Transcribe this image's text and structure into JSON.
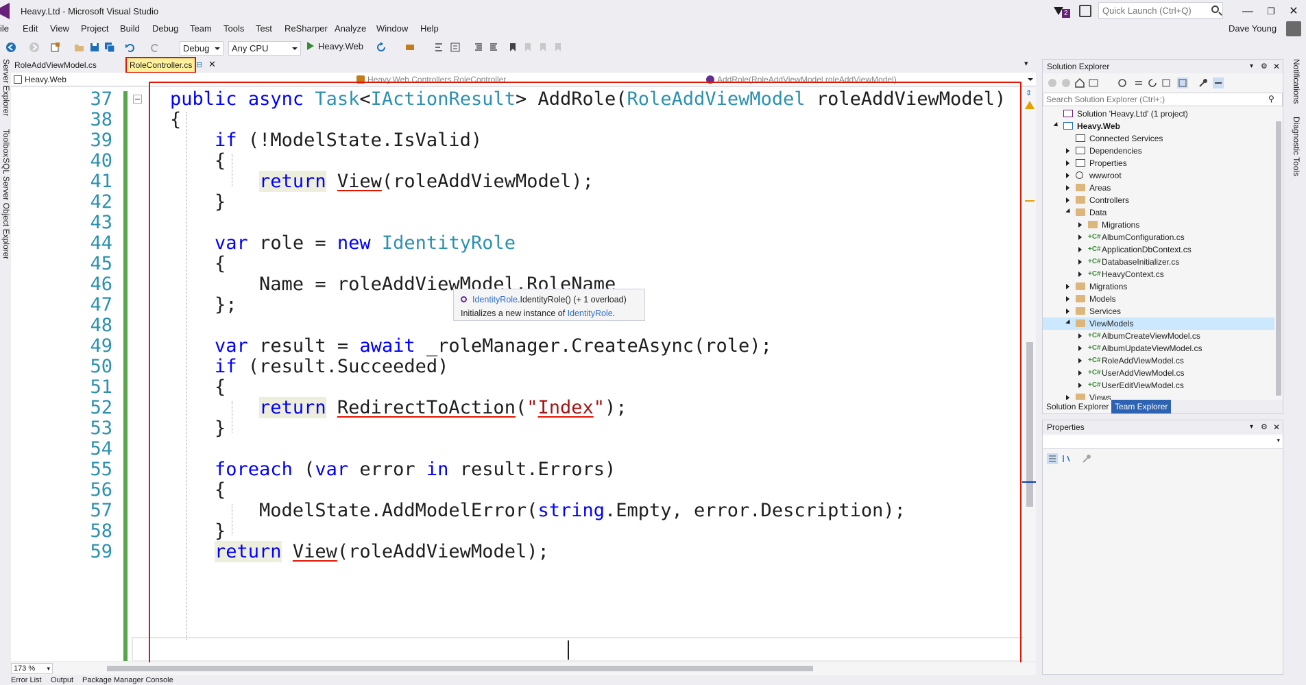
{
  "window": {
    "title": "Heavy.Ltd - Microsoft Visual Studio",
    "notifications_count": "2",
    "quick_launch_placeholder": "Quick Launch (Ctrl+Q)",
    "user_name": "Dave Young"
  },
  "menu": [
    "ile",
    "Edit",
    "View",
    "Project",
    "Build",
    "Debug",
    "Team",
    "Tools",
    "Test",
    "ReSharper",
    "Analyze",
    "Window",
    "Help"
  ],
  "toolbar": {
    "config": "Debug",
    "platform": "Any CPU",
    "run_label": "Heavy.Web"
  },
  "left_rail": [
    "Server Explorer",
    "Toolbox",
    "SQL Server Object Explorer"
  ],
  "right_rail": [
    "Notifications",
    "Diagnostic Tools"
  ],
  "doc_tabs": [
    {
      "label": "RoleAddViewModel.cs",
      "active": false
    },
    {
      "label": "RoleController.cs",
      "active": true
    }
  ],
  "navbar": {
    "project": "Heavy.Web",
    "class": "Heavy.Web.Controllers.RoleController",
    "member": "AddRole(RoleAddViewModel roleAddViewModel)"
  },
  "editor": {
    "zoom": "173 %",
    "line_numbers": [
      "37",
      "38",
      "39",
      "40",
      "41",
      "42",
      "43",
      "44",
      "45",
      "46",
      "47",
      "48",
      "49",
      "50",
      "51",
      "52",
      "53",
      "54",
      "55",
      "56",
      "57",
      "58",
      "59"
    ]
  },
  "tooltip": {
    "type_name": "IdentityRole",
    "signature": ".IdentityRole() (+ 1 overload)",
    "description_prefix": "Initializes a new instance of ",
    "description_link": "IdentityRole",
    "description_suffix": "."
  },
  "solution_explorer": {
    "title": "Solution Explorer",
    "search_placeholder": "Search Solution Explorer (Ctrl+;)",
    "nodes": [
      {
        "label": "Solution 'Heavy.Ltd' (1 project)",
        "level": 0,
        "kind": "solution",
        "exp": "none"
      },
      {
        "label": "Heavy.Web",
        "level": 0,
        "kind": "project",
        "exp": "open",
        "bold": true
      },
      {
        "label": "Connected Services",
        "level": 1,
        "kind": "service",
        "exp": "none"
      },
      {
        "label": "Dependencies",
        "level": 1,
        "kind": "deps",
        "exp": "closed"
      },
      {
        "label": "Properties",
        "level": 1,
        "kind": "wrench",
        "exp": "closed"
      },
      {
        "label": "wwwroot",
        "level": 1,
        "kind": "globe",
        "exp": "closed"
      },
      {
        "label": "Areas",
        "level": 1,
        "kind": "folder",
        "exp": "closed"
      },
      {
        "label": "Controllers",
        "level": 1,
        "kind": "folder",
        "exp": "closed"
      },
      {
        "label": "Data",
        "level": 1,
        "kind": "folder",
        "exp": "open"
      },
      {
        "label": "Migrations",
        "level": 2,
        "kind": "folder",
        "exp": "closed"
      },
      {
        "label": "AlbumConfiguration.cs",
        "level": 2,
        "kind": "cs",
        "exp": "closed"
      },
      {
        "label": "ApplicationDbContext.cs",
        "level": 2,
        "kind": "cs",
        "exp": "closed"
      },
      {
        "label": "DatabaseInitializer.cs",
        "level": 2,
        "kind": "cs",
        "exp": "closed"
      },
      {
        "label": "HeavyContext.cs",
        "level": 2,
        "kind": "cs",
        "exp": "closed"
      },
      {
        "label": "Migrations",
        "level": 1,
        "kind": "folder",
        "exp": "closed"
      },
      {
        "label": "Models",
        "level": 1,
        "kind": "folder",
        "exp": "closed"
      },
      {
        "label": "Services",
        "level": 1,
        "kind": "folder",
        "exp": "closed"
      },
      {
        "label": "ViewModels",
        "level": 1,
        "kind": "folder",
        "exp": "open",
        "selected": true
      },
      {
        "label": "AlbumCreateViewModel.cs",
        "level": 2,
        "kind": "cs",
        "exp": "closed"
      },
      {
        "label": "AlbumUpdateViewModel.cs",
        "level": 2,
        "kind": "cs",
        "exp": "closed"
      },
      {
        "label": "RoleAddViewModel.cs",
        "level": 2,
        "kind": "cs",
        "exp": "closed"
      },
      {
        "label": "UserAddViewModel.cs",
        "level": 2,
        "kind": "cs",
        "exp": "closed"
      },
      {
        "label": "UserEditViewModel.cs",
        "level": 2,
        "kind": "cs",
        "exp": "closed"
      },
      {
        "label": "Views",
        "level": 1,
        "kind": "folder",
        "exp": "closed"
      }
    ],
    "bottom_tabs": [
      "Solution Explorer",
      "Team Explorer"
    ]
  },
  "properties": {
    "title": "Properties"
  },
  "bottom_tabs": [
    "Error List",
    "Output",
    "Package Manager Console"
  ],
  "colors": {
    "accent": "#68217a",
    "keyword": "#0000ff",
    "type": "#2b91af",
    "string": "#a31515",
    "highlight_box": "#e51400"
  }
}
